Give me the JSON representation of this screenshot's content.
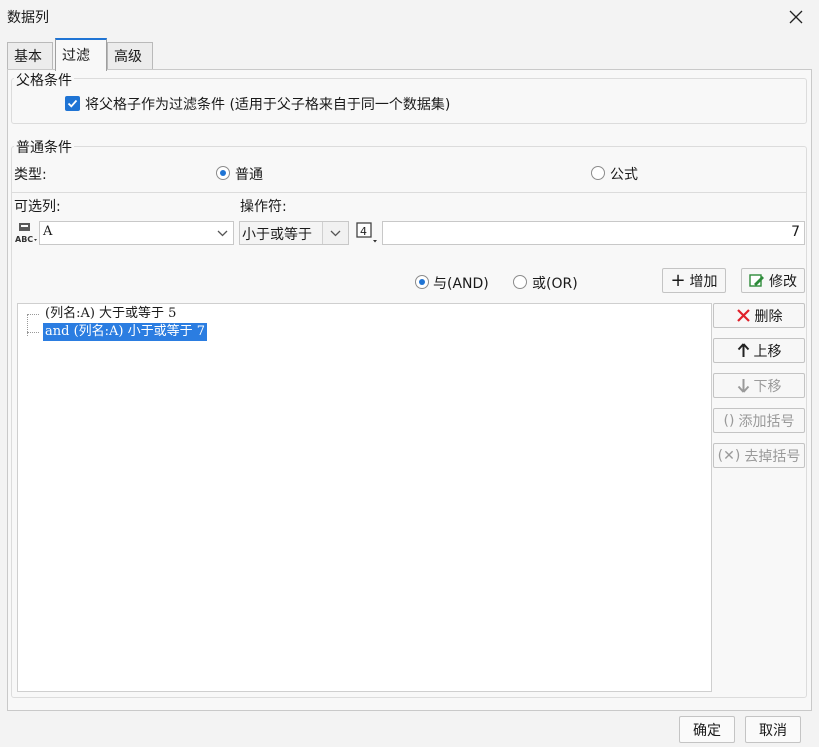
{
  "window": {
    "title": "数据列",
    "close_icon": "close-icon"
  },
  "tabs": [
    {
      "label": "基本",
      "active": false
    },
    {
      "label": "过滤",
      "active": true
    },
    {
      "label": "高级",
      "active": false
    }
  ],
  "parent_condition": {
    "group_label": "父格条件",
    "checkbox_label": "将父格子作为过滤条件 (适用于父子格来自于同一个数据集)",
    "checked": true
  },
  "normal_condition": {
    "group_label": "普通条件",
    "type_label": "类型:",
    "type_options": [
      {
        "label": "普通",
        "selected": true
      },
      {
        "label": "公式",
        "selected": false
      }
    ],
    "column_label": "可选列:",
    "operator_label": "操作符:",
    "column_value": "A",
    "operator_value": "小于或等于",
    "value_input": "7",
    "logic_options": [
      {
        "label": "与(AND)",
        "selected": true
      },
      {
        "label": "或(OR)",
        "selected": false
      }
    ],
    "add_button": "增加",
    "modify_button": "修改"
  },
  "conditions": [
    {
      "text": "(列名:A) 大于或等于 5",
      "selected": false
    },
    {
      "text": "and (列名:A) 小于或等于 7",
      "selected": true
    }
  ],
  "side_buttons": {
    "delete": "删除",
    "move_up": "上移",
    "move_down": "下移",
    "add_bracket": "添加括号",
    "remove_bracket": "去掉括号"
  },
  "footer": {
    "ok": "确定",
    "cancel": "取消"
  },
  "colors": {
    "accent": "#1f74d4",
    "selection": "#2b7de1",
    "delete_red": "#e0202a"
  }
}
